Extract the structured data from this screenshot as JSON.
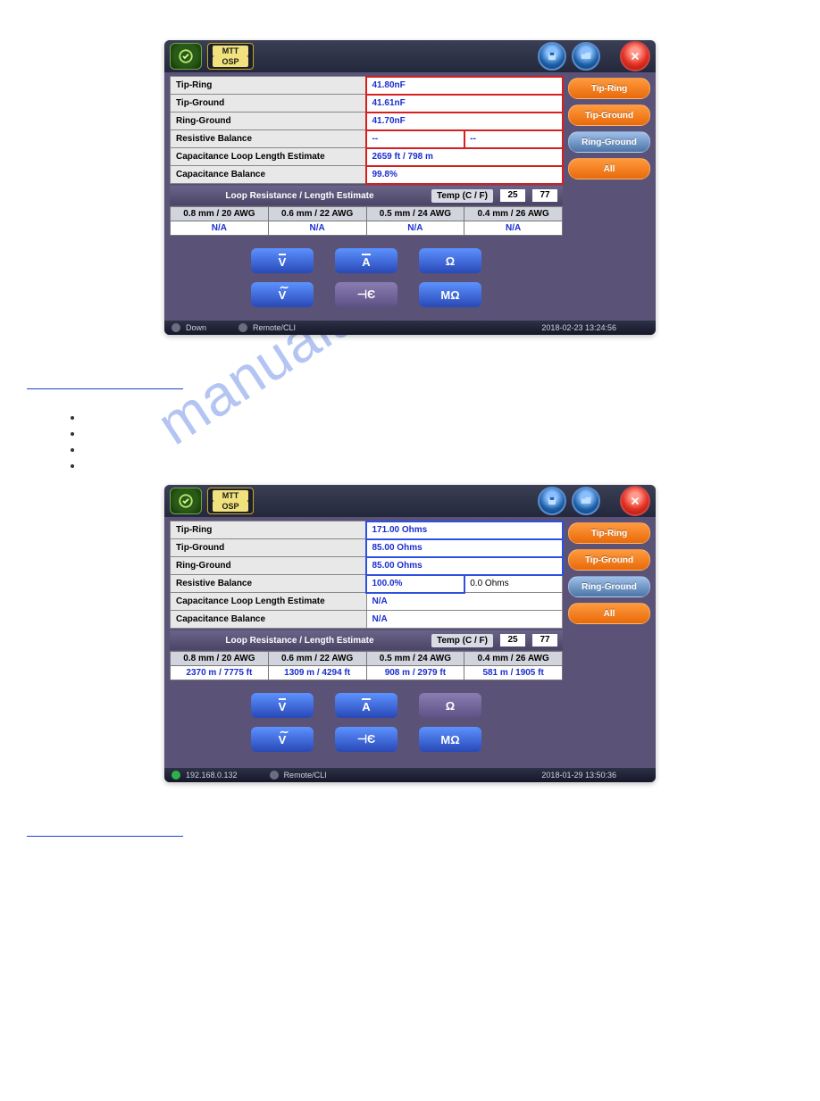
{
  "watermark": "manualarchive.com",
  "brand": {
    "line1": "MTT",
    "line2": "OSP"
  },
  "side_buttons": [
    {
      "name": "tip-ring",
      "label": "Tip-Ring",
      "style": "orange"
    },
    {
      "name": "tip-ground",
      "label": "Tip-Ground",
      "style": "orange"
    },
    {
      "name": "ring-ground",
      "label": "Ring-Ground",
      "style": "blue"
    },
    {
      "name": "all",
      "label": "All",
      "style": "orange"
    }
  ],
  "row_labels": {
    "tip_ring": "Tip-Ring",
    "tip_ground": "Tip-Ground",
    "ring_ground": "Ring-Ground",
    "resistive_balance": "Resistive Balance",
    "cap_loop_len": "Capacitance Loop Length Estimate",
    "cap_balance": "Capacitance Balance"
  },
  "loop_header": {
    "title": "Loop Resistance / Length Estimate",
    "temp_label": "Temp (C / F)",
    "temp_c": "25",
    "temp_f": "77"
  },
  "awg_cols": [
    "0.8 mm / 20 AWG",
    "0.6 mm / 22 AWG",
    "0.5 mm / 24 AWG",
    "0.4 mm / 26 AWG"
  ],
  "mode_buttons": {
    "vdc": "V",
    "vac": "V",
    "adc": "A",
    "cap": "⊣Є",
    "ohm": "Ω",
    "mohm": "MΩ"
  },
  "device1": {
    "highlight": "red",
    "vals": {
      "tip_ring": "41.80nF",
      "tip_ground": "41.61nF",
      "ring_ground": "41.70nF",
      "resistive_balance_a": "--",
      "resistive_balance_b": "--",
      "cap_loop_len": "2659 ft / 798 m",
      "cap_balance": "99.8%"
    },
    "awg_row": [
      "N/A",
      "N/A",
      "N/A",
      "N/A"
    ],
    "status": {
      "ip_label": "Down",
      "remote": "Remote/CLI",
      "timestamp": "2018-02-23  13:24:56",
      "ip_green": false,
      "ip_text": ""
    },
    "active_mode": "cap"
  },
  "device2": {
    "highlight": "blue",
    "vals": {
      "tip_ring": "171.00 Ohms",
      "tip_ground": "85.00 Ohms",
      "ring_ground": "85.00 Ohms",
      "resistive_balance_a": "100.0%",
      "resistive_balance_b": "0.0 Ohms",
      "cap_loop_len": "N/A",
      "cap_balance": "N/A"
    },
    "awg_row": [
      "2370 m /  7775 ft",
      "1309 m /  4294 ft",
      "908 m /  2979 ft",
      "581 m /  1905 ft"
    ],
    "status": {
      "ip_label": "",
      "remote": "Remote/CLI",
      "timestamp": "2018-01-29  13:50:36",
      "ip_green": true,
      "ip_text": "192.168.0.132"
    },
    "active_mode": "ohm"
  }
}
